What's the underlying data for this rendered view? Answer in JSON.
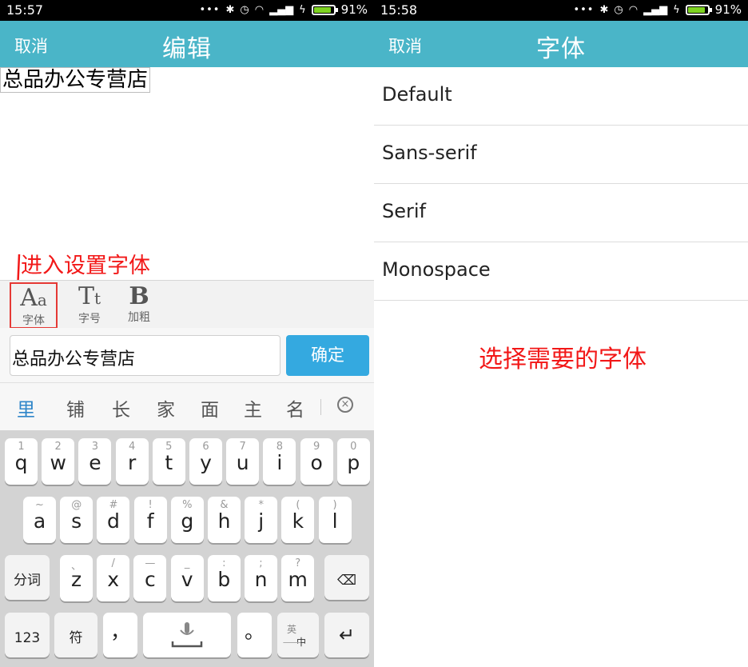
{
  "left": {
    "status": {
      "time": "15:57",
      "battery_pct": "91%",
      "battery_level": 0.91
    },
    "header": {
      "cancel": "取消",
      "title": "编辑"
    },
    "preview_text": "总品办公专营店",
    "annotation": "进入设置字体",
    "tools": {
      "font": {
        "glyph_big": "A",
        "glyph_small": "a",
        "label": "字体"
      },
      "size": {
        "glyph_big": "T",
        "glyph_small": "t",
        "label": "字号"
      },
      "bold": {
        "glyph": "B",
        "label": "加粗"
      }
    },
    "input": {
      "value": "总品办公专营店",
      "confirm": "确定"
    },
    "candidates": [
      "里",
      "铺",
      "长",
      "家",
      "面",
      "主",
      "名"
    ],
    "keyboard": {
      "row1": [
        {
          "sub": "1",
          "main": "q"
        },
        {
          "sub": "2",
          "main": "w"
        },
        {
          "sub": "3",
          "main": "e"
        },
        {
          "sub": "4",
          "main": "r"
        },
        {
          "sub": "5",
          "main": "t"
        },
        {
          "sub": "6",
          "main": "y"
        },
        {
          "sub": "7",
          "main": "u"
        },
        {
          "sub": "8",
          "main": "i"
        },
        {
          "sub": "9",
          "main": "o"
        },
        {
          "sub": "0",
          "main": "p"
        }
      ],
      "row2": [
        {
          "sub": "~",
          "main": "a"
        },
        {
          "sub": "@",
          "main": "s"
        },
        {
          "sub": "#",
          "main": "d"
        },
        {
          "sub": "!",
          "main": "f"
        },
        {
          "sub": "%",
          "main": "g"
        },
        {
          "sub": "&",
          "main": "h"
        },
        {
          "sub": "*",
          "main": "j"
        },
        {
          "sub": "(",
          "main": "k"
        },
        {
          "sub": ")",
          "main": "l"
        }
      ],
      "row3": [
        {
          "sub": "、",
          "main": "z"
        },
        {
          "sub": "/",
          "main": "x"
        },
        {
          "sub": "—",
          "main": "c"
        },
        {
          "sub": "_",
          "main": "v"
        },
        {
          "sub": ":",
          "main": "b"
        },
        {
          "sub": ";",
          "main": "n"
        },
        {
          "sub": "?",
          "main": "m"
        }
      ],
      "fenci": "分词",
      "num": "123",
      "fu": "符",
      "comma": "，",
      "period": "。",
      "lang_top": "英",
      "lang_bottom": "中"
    }
  },
  "right": {
    "status": {
      "time": "15:58",
      "battery_pct": "91%",
      "battery_level": 0.91
    },
    "header": {
      "cancel": "取消",
      "title": "字体"
    },
    "fonts": [
      "Default",
      "Sans-serif",
      "Serif",
      "Monospace"
    ],
    "annotation": "选择需要的字体"
  }
}
